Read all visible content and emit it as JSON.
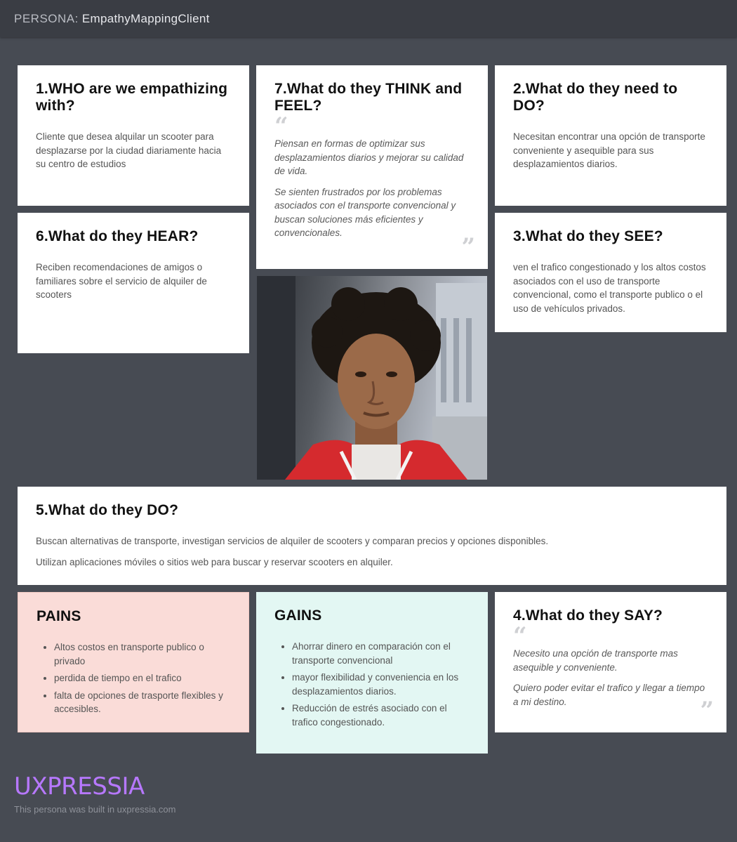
{
  "header": {
    "persona_label": "PERSONA:",
    "persona_name": "EmpathyMappingClient"
  },
  "who": {
    "title": "1.WHO are we empathizing with?",
    "text": "Cliente que desea alquilar un scooter para desplazarse por la ciudad diariamente hacia su centro de estudios"
  },
  "think_feel": {
    "title": "7.What do they THINK and FEEL?",
    "quotes": [
      "Piensan en formas de optimizar sus desplazamientos diarios y mejorar su calidad de vida.",
      "Se sienten frustrados por los problemas asociados con el transporte convencional y buscan soluciones más eficientes y convencionales."
    ]
  },
  "need": {
    "title": "2.What do they need to DO?",
    "text": "Necesitan encontrar una opción de transporte conveniente y asequible para sus desplazamientos diarios."
  },
  "hear": {
    "title": "6.What do they HEAR?",
    "text": "Reciben recomendaciones de amigos o familiares sobre el servicio de alquiler de scooters"
  },
  "see": {
    "title": "3.What do they SEE?",
    "text": "ven el trafico congestionado y los altos costos asociados con el uso de transporte convencional, como el transporte publico o el uso de vehículos privados."
  },
  "do": {
    "title": "5.What do they DO?",
    "paragraphs": [
      "Buscan alternativas de transporte, investigan servicios de alquiler de scooters y comparan precios y opciones disponibles.",
      "Utilizan aplicaciones móviles o sitios web para buscar y reservar scooters en alquiler."
    ]
  },
  "pains": {
    "title": "PAINS",
    "items": [
      "Altos costos en transporte publico o privado",
      "perdida de tiempo en el trafico",
      "falta de opciones de trasporte flexibles y accesibles."
    ]
  },
  "gains": {
    "title": "GAINS",
    "items": [
      "Ahorrar dinero en comparación con el transporte convencional",
      "mayor flexibilidad y conveniencia en los desplazamientos diarios.",
      "Reducción de estrés asociado con el trafico congestionado."
    ]
  },
  "say": {
    "title": "4.What do they SAY?",
    "quotes": [
      "Necesito una opción de transporte mas asequible y conveniente.",
      "Quiero poder evitar el trafico y llegar a tiempo a mi destino."
    ]
  },
  "footer": {
    "brand": "UXPRESSIA",
    "note": "This persona was built in uxpressia.com"
  },
  "colors": {
    "background": "#474b53",
    "topbar": "#3a3d44",
    "pains_bg": "#fadcd8",
    "gains_bg": "#e3f7f3",
    "brand": "#b778ff"
  },
  "icons": {
    "open_quote": "“",
    "close_quote": "”"
  }
}
